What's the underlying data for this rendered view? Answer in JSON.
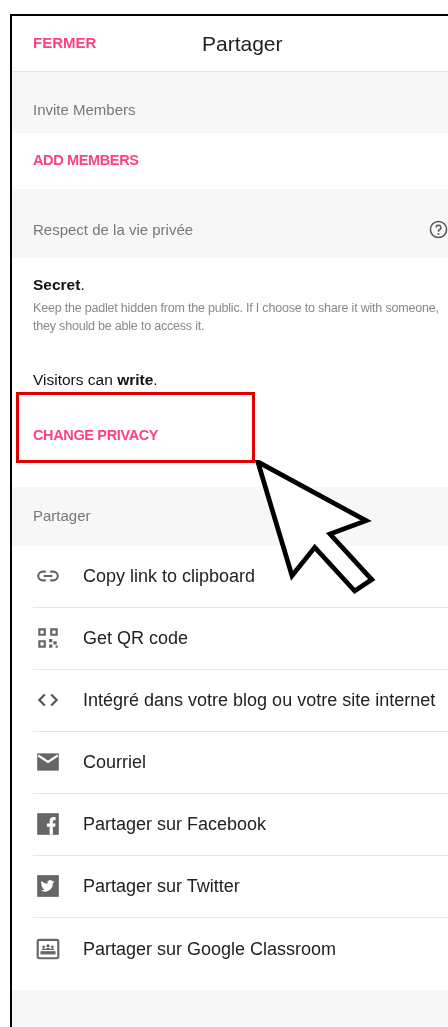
{
  "header": {
    "close": "FERMER",
    "title": "Partager"
  },
  "invite": {
    "heading": "Invite Members",
    "action": "ADD MEMBERS"
  },
  "privacy": {
    "heading": "Respect de la vie privée",
    "level_name": "**Secret**.",
    "description": "Keep the padlet hidden from the public. If I choose to share it with someone, they should be able to access it.",
    "visitors": "Visitors can **write**.",
    "action": "CHANGE PRIVACY",
    "highlighted": true
  },
  "share": {
    "heading": "Partager",
    "items": [
      {
        "kind": "link",
        "label": "Copy link to clipboard"
      },
      {
        "kind": "qr",
        "label": "Get QR code"
      },
      {
        "kind": "embed",
        "label": "Intégré dans votre blog ou votre site internet"
      },
      {
        "kind": "email",
        "label": "Courriel"
      },
      {
        "kind": "facebook",
        "label": "Partager sur Facebook"
      },
      {
        "kind": "twitter",
        "label": "Partager sur Twitter"
      },
      {
        "kind": "classroom",
        "label": "Partager sur Google Classroom"
      }
    ]
  }
}
